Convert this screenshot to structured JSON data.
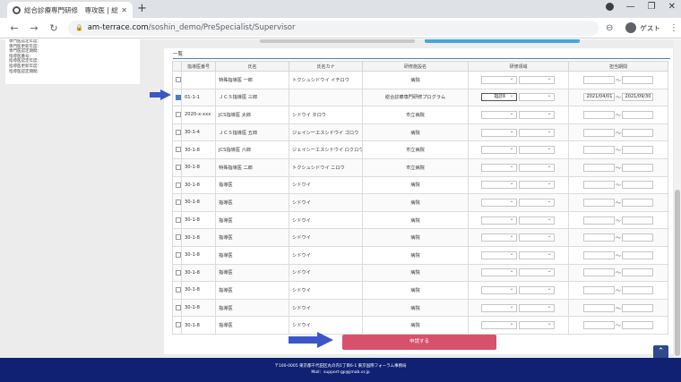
{
  "browser": {
    "tab_title": "総合診療専門研修　専攻医 | 総合",
    "url_host": "am-terrace.com",
    "url_path": "/soshin_demo/PreSpecialist/Supervisor",
    "account_label": "ゲスト"
  },
  "sidebar": {
    "lines": [
      "専門医認定年度：",
      "専門医更新年度：",
      "専門医認定期間：",
      "指導医番号：",
      "指導医認定年度：",
      "指導医更新年度：",
      "指導医認定期間："
    ]
  },
  "section": {
    "title": "一覧"
  },
  "table": {
    "headers": [
      "指導医番号",
      "氏名",
      "氏名カナ",
      "研修施設名",
      "研修領域",
      "担当期間"
    ],
    "rows": [
      {
        "checked": false,
        "number": "",
        "name": "特殊指導医 一郎",
        "kana": "トクシュシドウイ イチロウ",
        "facility": "病院",
        "area": "",
        "from": "",
        "to": ""
      },
      {
        "checked": true,
        "number": "01-1-1",
        "name": "ＪＣＳ指導医 三郎",
        "kana": "",
        "facility": "総合診療専門研修プログラム",
        "area": "指診Ⅱ",
        "from": "2021/04/01",
        "to": "2021/09/30"
      },
      {
        "checked": false,
        "number": "2020-x-xxx",
        "name": "JCS指導医 太郎",
        "kana": "シドウイ タロウ",
        "facility": "市立病院",
        "area": "",
        "from": "",
        "to": ""
      },
      {
        "checked": false,
        "number": "30-1-4",
        "name": "ＪＣＳ指導医 五郎",
        "kana": "ジェイシーエスシドウイ ゴロウ",
        "facility": "病院",
        "area": "",
        "from": "",
        "to": ""
      },
      {
        "checked": false,
        "number": "30-1-8",
        "name": "JCS指導医 六郎",
        "kana": "ジェイシーエスシドウイ ロクロウ",
        "facility": "市立病院",
        "area": "",
        "from": "",
        "to": ""
      },
      {
        "checked": false,
        "number": "30-1-8",
        "name": "特殊指導医 二郎",
        "kana": "トクシュシドウイ ニロウ",
        "facility": "市立病院",
        "area": "",
        "from": "",
        "to": ""
      },
      {
        "checked": false,
        "number": "30-1-8",
        "name": "指導医",
        "kana": "シドウイ",
        "facility": "病院",
        "area": "",
        "from": "",
        "to": ""
      },
      {
        "checked": false,
        "number": "30-1-8",
        "name": "指導医",
        "kana": "シドウイ",
        "facility": "病院",
        "area": "",
        "from": "",
        "to": ""
      },
      {
        "checked": false,
        "number": "30-1-8",
        "name": "指導医",
        "kana": "シドウイ",
        "facility": "病院",
        "area": "",
        "from": "",
        "to": ""
      },
      {
        "checked": false,
        "number": "30-1-8",
        "name": "指導医",
        "kana": "シドウイ",
        "facility": "病院",
        "area": "",
        "from": "",
        "to": ""
      },
      {
        "checked": false,
        "number": "30-1-8",
        "name": "指導医",
        "kana": "シドウイ",
        "facility": "病院",
        "area": "",
        "from": "",
        "to": ""
      },
      {
        "checked": false,
        "number": "30-1-8",
        "name": "指導医",
        "kana": "シドウイ",
        "facility": "病院",
        "area": "",
        "from": "",
        "to": ""
      },
      {
        "checked": false,
        "number": "30-1-8",
        "name": "指導医",
        "kana": "シドウイ",
        "facility": "病院",
        "area": "",
        "from": "",
        "to": ""
      },
      {
        "checked": false,
        "number": "30-1-8",
        "name": "指導医",
        "kana": "シドウイ",
        "facility": "病院",
        "area": "",
        "from": "",
        "to": ""
      },
      {
        "checked": false,
        "number": "30-1-8",
        "name": "指導医",
        "kana": "シドウイ",
        "facility": "病院",
        "area": "",
        "from": "",
        "to": ""
      }
    ],
    "range_separator": "～"
  },
  "apply_button": {
    "label": "申請する"
  },
  "footer": {
    "address": "〒100-0005 東京都千代田区丸の内1丁目6-1 東京国際フォーラム事務局",
    "mail": "Mail：support-gp@jmab.or.jp"
  },
  "colors": {
    "accent_blue": "#45a7d8",
    "apply_red": "#d8506b",
    "footer_navy": "#102072",
    "arrow_blue": "#3b57c7"
  }
}
